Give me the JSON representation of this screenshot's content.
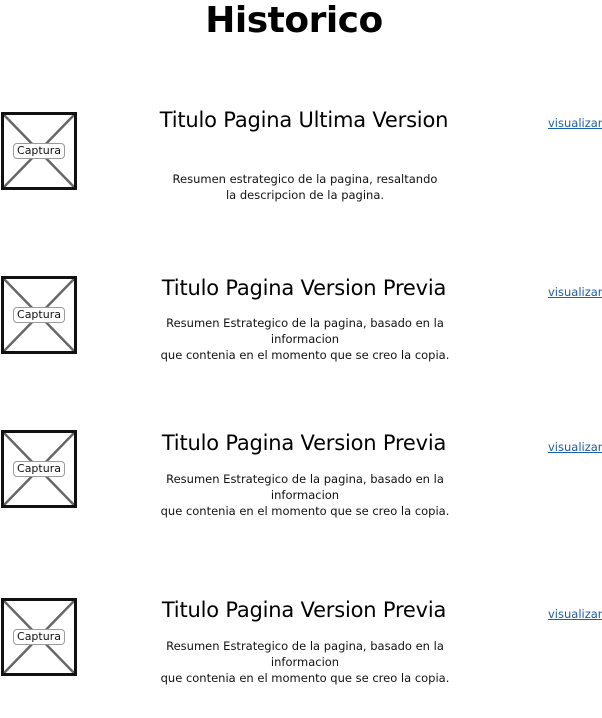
{
  "page": {
    "title": "Historico"
  },
  "colors": {
    "link": "#1f5ea8",
    "text": "#000000",
    "placeholder_border": "#111111",
    "placeholder_cross": "#666666"
  },
  "entries": [
    {
      "thumbnail_icon": "image-placeholder-icon",
      "thumbnail_label": "Captura",
      "title": "Titulo Pagina Ultima Version",
      "summary_lines": [
        "Resumen estrategico de la pagina, resaltando",
        "la descripcion de la pagina."
      ],
      "link_label": "visualizar"
    },
    {
      "thumbnail_icon": "image-placeholder-icon",
      "thumbnail_label": "Captura",
      "title": "Titulo Pagina Version Previa",
      "summary_lines": [
        "Resumen Estrategico de la pagina, basado en la",
        "informacion",
        "que contenia en el momento que se creo la copia."
      ],
      "link_label": "visualizar"
    },
    {
      "thumbnail_icon": "image-placeholder-icon",
      "thumbnail_label": "Captura",
      "title": "Titulo Pagina Version Previa",
      "summary_lines": [
        "Resumen Estrategico de la pagina, basado en la",
        "informacion",
        "que contenia en el momento que se creo la copia."
      ],
      "link_label": "visualizar"
    },
    {
      "thumbnail_icon": "image-placeholder-icon",
      "thumbnail_label": "Captura",
      "title": "Titulo Pagina Version Previa",
      "summary_lines": [
        "Resumen Estrategico de la pagina, basado en la",
        "informacion",
        "que contenia en el momento que se creo la copia."
      ],
      "link_label": "visualizar"
    }
  ]
}
